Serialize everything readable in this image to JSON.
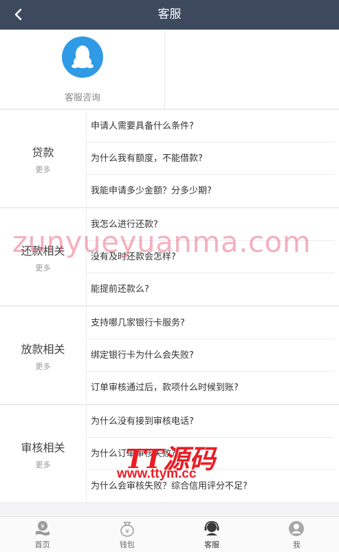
{
  "header": {
    "title": "客服",
    "back_icon": "chevron-left-icon"
  },
  "service": {
    "label": "客服咨询",
    "icon": "qq-penguin-icon",
    "icon_color": "#2f9be6"
  },
  "sections": [
    {
      "name": "贷款",
      "more": "更多",
      "questions": [
        "申请人需要具备什么条件?",
        "为什么我有额度，不能借款?",
        "我能申请多少金额？分多少期?"
      ]
    },
    {
      "name": "还款相关",
      "more": "更多",
      "questions": [
        "我怎么进行还款?",
        "没有及时还款会怎样?",
        "能提前还款么?"
      ]
    },
    {
      "name": "放款相关",
      "more": "更多",
      "questions": [
        "支持哪几家银行卡服务?",
        "绑定银行卡为什么会失败?",
        "订单审核通过后，款项什么时候到账?"
      ]
    },
    {
      "name": "审核相关",
      "more": "更多",
      "questions": [
        "为什么没有接到审核电话?",
        "为什么订单审核失败?",
        "为什么会审核失败？综合信用评分不足?"
      ]
    }
  ],
  "watermarks": {
    "site": "zunyueyuanma.com",
    "logo": "TT源码",
    "url": "www.ttym.cc"
  },
  "tabbar": [
    {
      "label": "首页",
      "icon": "home-yen-icon"
    },
    {
      "label": "钱包",
      "icon": "wallet-icon"
    },
    {
      "label": "客服",
      "icon": "customer-service-icon",
      "active": true
    },
    {
      "label": "我",
      "icon": "user-icon"
    }
  ],
  "colors": {
    "header_bg": "#3d4a5e",
    "accent": "#2f9be6"
  }
}
